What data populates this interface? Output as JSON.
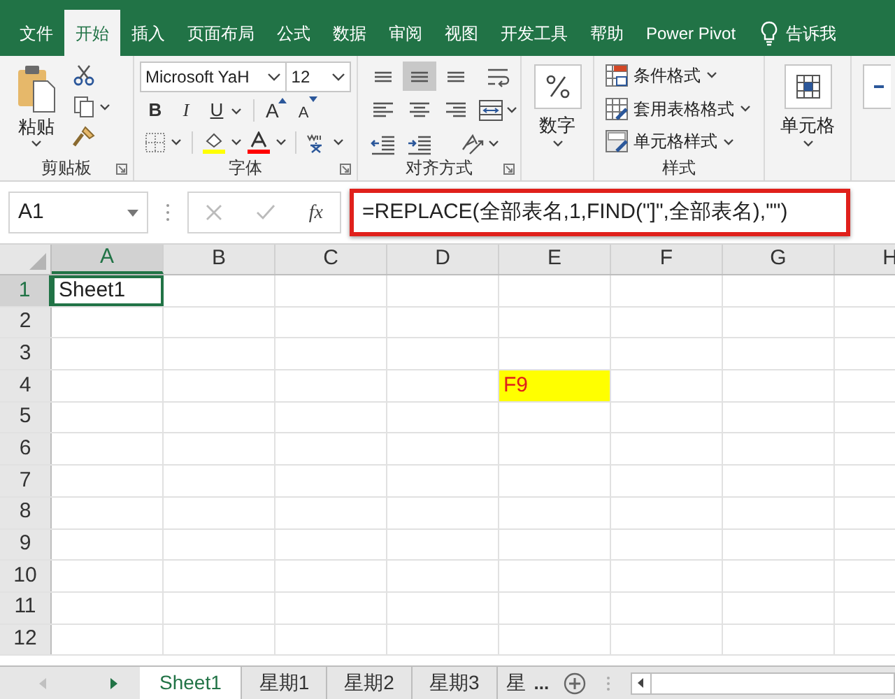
{
  "menu_tabs": [
    {
      "label": "文件",
      "selected": false
    },
    {
      "label": "开始",
      "selected": true
    },
    {
      "label": "插入",
      "selected": false
    },
    {
      "label": "页面布局",
      "selected": false
    },
    {
      "label": "公式",
      "selected": false
    },
    {
      "label": "数据",
      "selected": false
    },
    {
      "label": "审阅",
      "selected": false
    },
    {
      "label": "视图",
      "selected": false
    },
    {
      "label": "开发工具",
      "selected": false
    },
    {
      "label": "帮助",
      "selected": false
    },
    {
      "label": "Power Pivot",
      "selected": false
    }
  ],
  "tell_me": {
    "label": "告诉我"
  },
  "ribbon": {
    "clipboard": {
      "paste": "粘贴",
      "label": "剪贴板"
    },
    "font": {
      "font_name": "Microsoft YaH",
      "font_size": "12",
      "bold": "B",
      "italic": "I",
      "underline": "U",
      "grow": "A",
      "shrink": "A",
      "label": "字体"
    },
    "alignment": {
      "buttons": [
        {
          "kind": "top",
          "selected": false
        },
        {
          "kind": "middle",
          "selected": true
        },
        {
          "kind": "bottom",
          "selected": false
        },
        {
          "kind": "wrap",
          "selected": false
        },
        {
          "kind": "left",
          "selected": false
        },
        {
          "kind": "center",
          "selected": false
        },
        {
          "kind": "right",
          "selected": false
        },
        {
          "kind": "merge",
          "selected": false
        },
        {
          "kind": "outdent",
          "selected": false
        },
        {
          "kind": "indent",
          "selected": false
        },
        {
          "kind": "orientation",
          "selected": false
        }
      ],
      "label": "对齐方式"
    },
    "number": {
      "button": "数字"
    },
    "styles": {
      "items": [
        "条件格式",
        "套用表格格式",
        "单元格样式"
      ],
      "label": "样式"
    },
    "cells": {
      "button": "单元格"
    }
  },
  "formula_bar": {
    "name_box": "A1",
    "function_label": "fx",
    "formula": "=REPLACE(全部表名,1,FIND(\"]\",全部表名),\"\")",
    "annotated": true
  },
  "sheet": {
    "columns": [
      {
        "label": "A",
        "selected": true
      },
      {
        "label": "B",
        "selected": false
      },
      {
        "label": "C",
        "selected": false
      },
      {
        "label": "D",
        "selected": false
      },
      {
        "label": "E",
        "selected": false
      },
      {
        "label": "F",
        "selected": false
      },
      {
        "label": "G",
        "selected": false
      },
      {
        "label": "H",
        "selected": false
      }
    ],
    "rows": [
      {
        "header": "1",
        "selected": true,
        "cells": [
          {
            "text": "Sheet1",
            "selected": true,
            "highlighted": false
          },
          {
            "selected": false,
            "highlighted": false
          },
          {
            "selected": false,
            "highlighted": false
          },
          {
            "selected": false,
            "highlighted": false
          },
          {
            "selected": false,
            "highlighted": false
          },
          {
            "selected": false,
            "highlighted": false
          },
          {
            "selected": false,
            "highlighted": false
          },
          {
            "selected": false,
            "highlighted": false
          }
        ]
      },
      {
        "header": "2",
        "selected": false,
        "cells": [
          {
            "selected": false,
            "highlighted": false
          },
          {
            "selected": false,
            "highlighted": false
          },
          {
            "selected": false,
            "highlighted": false
          },
          {
            "selected": false,
            "highlighted": false
          },
          {
            "selected": false,
            "highlighted": false
          },
          {
            "selected": false,
            "highlighted": false
          },
          {
            "selected": false,
            "highlighted": false
          },
          {
            "selected": false,
            "highlighted": false
          }
        ]
      },
      {
        "header": "3",
        "selected": false,
        "cells": [
          {
            "selected": false,
            "highlighted": false
          },
          {
            "selected": false,
            "highlighted": false
          },
          {
            "selected": false,
            "highlighted": false
          },
          {
            "selected": false,
            "highlighted": false
          },
          {
            "selected": false,
            "highlighted": false
          },
          {
            "selected": false,
            "highlighted": false
          },
          {
            "selected": false,
            "highlighted": false
          },
          {
            "selected": false,
            "highlighted": false
          }
        ]
      },
      {
        "header": "4",
        "selected": false,
        "cells": [
          {
            "selected": false,
            "highlighted": false
          },
          {
            "selected": false,
            "highlighted": false
          },
          {
            "selected": false,
            "highlighted": false
          },
          {
            "selected": false,
            "highlighted": false
          },
          {
            "text": "F9",
            "selected": false,
            "highlighted": true
          },
          {
            "selected": false,
            "highlighted": false
          },
          {
            "selected": false,
            "highlighted": false
          },
          {
            "selected": false,
            "highlighted": false
          }
        ]
      },
      {
        "header": "5",
        "selected": false,
        "cells": [
          {
            "selected": false,
            "highlighted": false
          },
          {
            "selected": false,
            "highlighted": false
          },
          {
            "selected": false,
            "highlighted": false
          },
          {
            "selected": false,
            "highlighted": false
          },
          {
            "selected": false,
            "highlighted": false
          },
          {
            "selected": false,
            "highlighted": false
          },
          {
            "selected": false,
            "highlighted": false
          },
          {
            "selected": false,
            "highlighted": false
          }
        ]
      },
      {
        "header": "6",
        "selected": false,
        "cells": [
          {
            "selected": false,
            "highlighted": false
          },
          {
            "selected": false,
            "highlighted": false
          },
          {
            "selected": false,
            "highlighted": false
          },
          {
            "selected": false,
            "highlighted": false
          },
          {
            "selected": false,
            "highlighted": false
          },
          {
            "selected": false,
            "highlighted": false
          },
          {
            "selected": false,
            "highlighted": false
          },
          {
            "selected": false,
            "highlighted": false
          }
        ]
      },
      {
        "header": "7",
        "selected": false,
        "cells": [
          {
            "selected": false,
            "highlighted": false
          },
          {
            "selected": false,
            "highlighted": false
          },
          {
            "selected": false,
            "highlighted": false
          },
          {
            "selected": false,
            "highlighted": false
          },
          {
            "selected": false,
            "highlighted": false
          },
          {
            "selected": false,
            "highlighted": false
          },
          {
            "selected": false,
            "highlighted": false
          },
          {
            "selected": false,
            "highlighted": false
          }
        ]
      },
      {
        "header": "8",
        "selected": false,
        "cells": [
          {
            "selected": false,
            "highlighted": false
          },
          {
            "selected": false,
            "highlighted": false
          },
          {
            "selected": false,
            "highlighted": false
          },
          {
            "selected": false,
            "highlighted": false
          },
          {
            "selected": false,
            "highlighted": false
          },
          {
            "selected": false,
            "highlighted": false
          },
          {
            "selected": false,
            "highlighted": false
          },
          {
            "selected": false,
            "highlighted": false
          }
        ]
      },
      {
        "header": "9",
        "selected": false,
        "cells": [
          {
            "selected": false,
            "highlighted": false
          },
          {
            "selected": false,
            "highlighted": false
          },
          {
            "selected": false,
            "highlighted": false
          },
          {
            "selected": false,
            "highlighted": false
          },
          {
            "selected": false,
            "highlighted": false
          },
          {
            "selected": false,
            "highlighted": false
          },
          {
            "selected": false,
            "highlighted": false
          },
          {
            "selected": false,
            "highlighted": false
          }
        ]
      },
      {
        "header": "10",
        "selected": false,
        "cells": [
          {
            "selected": false,
            "highlighted": false
          },
          {
            "selected": false,
            "highlighted": false
          },
          {
            "selected": false,
            "highlighted": false
          },
          {
            "selected": false,
            "highlighted": false
          },
          {
            "selected": false,
            "highlighted": false
          },
          {
            "selected": false,
            "highlighted": false
          },
          {
            "selected": false,
            "highlighted": false
          },
          {
            "selected": false,
            "highlighted": false
          }
        ]
      },
      {
        "header": "11",
        "selected": false,
        "cells": [
          {
            "selected": false,
            "highlighted": false
          },
          {
            "selected": false,
            "highlighted": false
          },
          {
            "selected": false,
            "highlighted": false
          },
          {
            "selected": false,
            "highlighted": false
          },
          {
            "selected": false,
            "highlighted": false
          },
          {
            "selected": false,
            "highlighted": false
          },
          {
            "selected": false,
            "highlighted": false
          },
          {
            "selected": false,
            "highlighted": false
          }
        ]
      },
      {
        "header": "12",
        "selected": false,
        "cells": [
          {
            "selected": false,
            "highlighted": false
          },
          {
            "selected": false,
            "highlighted": false
          },
          {
            "selected": false,
            "highlighted": false
          },
          {
            "selected": false,
            "highlighted": false
          },
          {
            "selected": false,
            "highlighted": false
          },
          {
            "selected": false,
            "highlighted": false
          },
          {
            "selected": false,
            "highlighted": false
          },
          {
            "selected": false,
            "highlighted": false
          }
        ]
      }
    ]
  },
  "sheet_tabs": {
    "tabs": [
      {
        "label": "Sheet1",
        "selected": true
      },
      {
        "label": "星期1",
        "selected": false
      },
      {
        "label": "星期2",
        "selected": false
      },
      {
        "label": "星期3",
        "selected": false
      },
      {
        "label": "星",
        "selected": false
      }
    ],
    "overflow": "..."
  }
}
